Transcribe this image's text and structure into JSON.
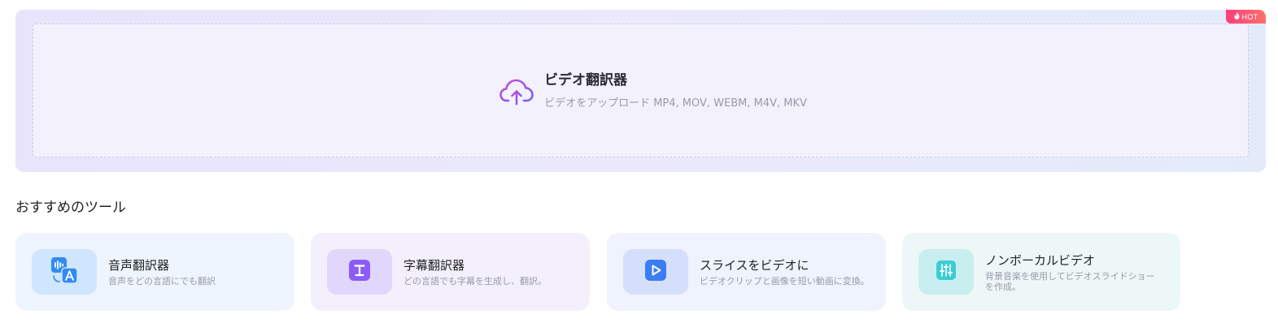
{
  "upload": {
    "title": "ビデオ翻訳器",
    "subtitle": "ビデオをアップロード MP4, MOV, WEBM, M4V, MKV",
    "icon": "cloud-upload-icon",
    "badge": "HOT"
  },
  "recommended": {
    "heading": "おすすめのツール",
    "tools": [
      {
        "title": "音声翻訳器",
        "desc": "音声をどの言語にでも翻訳",
        "icon": "voice-translate-icon"
      },
      {
        "title": "字幕翻訳器",
        "desc": "どの言語でも字幕を生成し、翻訳。",
        "icon": "subtitle-icon"
      },
      {
        "title": "スライスをビデオに",
        "desc": "ビデオクリップと画像を短い動画に変換。",
        "icon": "play-icon"
      },
      {
        "title": "ノンボーカルビデオ",
        "desc": "背景音楽を使用してビデオスライドショーを作成。",
        "icon": "equalizer-icon"
      }
    ]
  },
  "colors": {
    "accent_purple": "#8b5cf6",
    "accent_blue": "#2f8cf5",
    "hot_badge": "#ff4d79",
    "teal": "#3ccdd2"
  }
}
